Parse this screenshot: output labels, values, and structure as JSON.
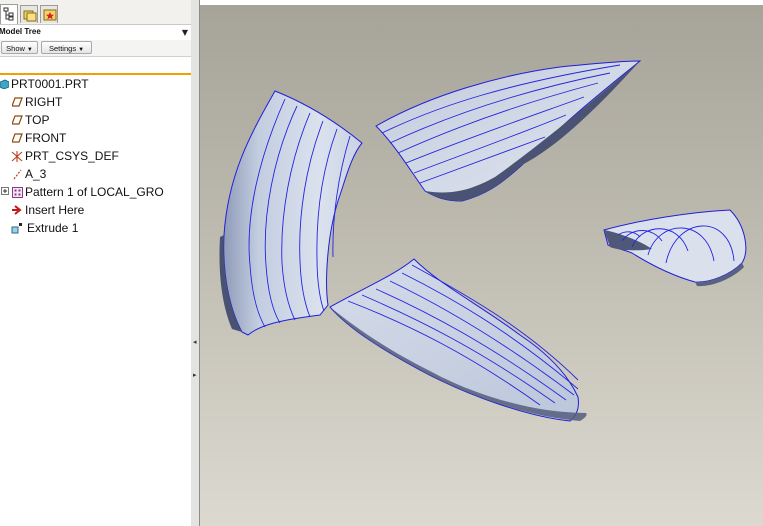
{
  "model_tree": {
    "header_label": "Model Tree",
    "show_button": "Show",
    "settings_button": "Settings",
    "items": [
      {
        "label": "PRT0001.PRT",
        "icon": "part-icon"
      },
      {
        "label": "RIGHT",
        "icon": "datum-plane-icon"
      },
      {
        "label": "TOP",
        "icon": "datum-plane-icon"
      },
      {
        "label": "FRONT",
        "icon": "datum-plane-icon"
      },
      {
        "label": "PRT_CSYS_DEF",
        "icon": "csys-icon"
      },
      {
        "label": "A_3",
        "icon": "datum-axis-icon"
      },
      {
        "label": "Pattern 1 of LOCAL_GRO",
        "icon": "pattern-icon"
      },
      {
        "label": "Insert Here",
        "icon": "insert-arrow-icon"
      },
      {
        "label": "Extrude 1",
        "icon": "extrude-icon"
      }
    ]
  },
  "tabs": [
    {
      "name": "model-tree-tab",
      "icon": "tree-icon"
    },
    {
      "name": "folder-browser-tab",
      "icon": "folder-icon"
    },
    {
      "name": "favorites-tab",
      "icon": "favorites-icon"
    }
  ],
  "colors": {
    "accent_line": "#f2a000",
    "surface_edge": "#2020e0",
    "surface_fill": "#c7d1e2",
    "surface_shadow": "#5a6480"
  }
}
